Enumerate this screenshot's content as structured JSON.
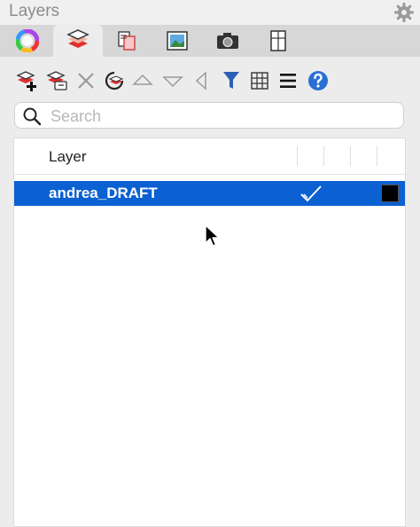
{
  "panel": {
    "title": "Layers"
  },
  "tabs": [
    {
      "name": "color-wheel-tab",
      "active": false
    },
    {
      "name": "layers-tab",
      "active": true
    },
    {
      "name": "layer-stack-tab",
      "active": false
    },
    {
      "name": "image-tab",
      "active": false
    },
    {
      "name": "camera-tab",
      "active": false
    },
    {
      "name": "page-layout-tab",
      "active": false
    }
  ],
  "search": {
    "placeholder": "Search",
    "value": ""
  },
  "table": {
    "column_header": "Layer",
    "rows": [
      {
        "name": "andrea_DRAFT",
        "selected": true,
        "visible_check": true,
        "color": "#000000"
      }
    ]
  },
  "colors": {
    "selection": "#0b60d2",
    "help": "#2a6fd6",
    "filter": "#2b5fb5"
  }
}
